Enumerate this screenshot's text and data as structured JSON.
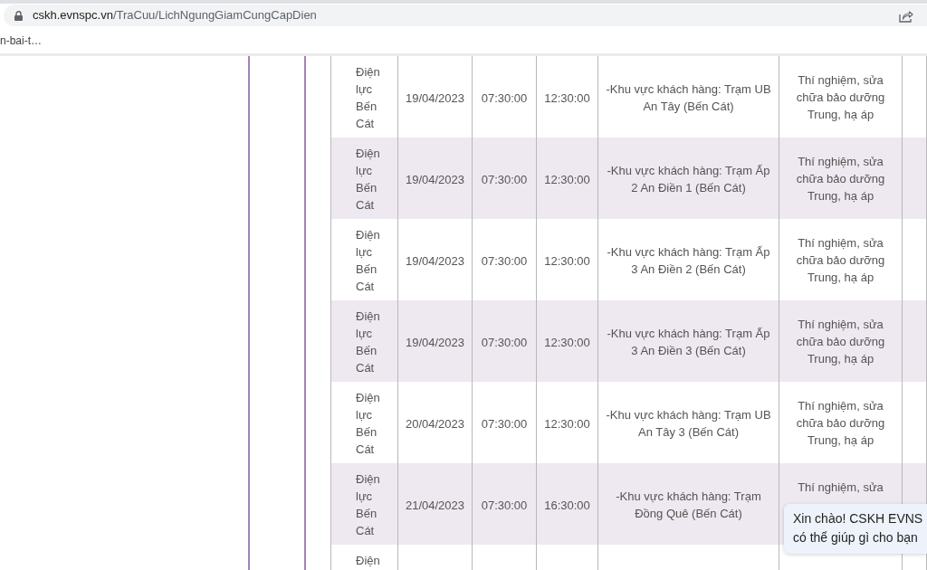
{
  "browser": {
    "address": {
      "host": "cskh.evnspc.vn",
      "path": "/TraCuu/LichNgungGiamCungCapDien"
    },
    "bookmarks": [
      {
        "label": "n-bai-t…"
      }
    ]
  },
  "table": {
    "rows": [
      {
        "cells": [
          "Điện lực Bến Cát",
          "19/04/2023",
          "07:30:00",
          "12:30:00",
          "-Khu vực khách hàng: Trạm UB An Tây (Bến Cát)",
          "Thí nghiệm, sửa chữa bảo dưỡng Trung, hạ áp"
        ]
      },
      {
        "cells": [
          "Điện lực Bến Cát",
          "19/04/2023",
          "07:30:00",
          "12:30:00",
          "-Khu vực khách hàng: Trạm Ấp 2 An Điền 1 (Bến Cát)",
          "Thí nghiệm, sửa chữa bảo dưỡng Trung, hạ áp"
        ]
      },
      {
        "cells": [
          "Điện lực Bến Cát",
          "19/04/2023",
          "07:30:00",
          "12:30:00",
          "-Khu vực khách hàng: Trạm Ấp 3 An Điền 2 (Bến Cát)",
          "Thí nghiệm, sửa chữa bảo dưỡng Trung, hạ áp"
        ]
      },
      {
        "cells": [
          "Điện lực Bến Cát",
          "19/04/2023",
          "07:30:00",
          "12:30:00",
          "-Khu vực khách hàng: Trạm Ấp 3 An Điền 3 (Bến Cát)",
          "Thí nghiệm, sửa chữa bảo dưỡng Trung, hạ áp"
        ]
      },
      {
        "cells": [
          "Điện lực Bến Cát",
          "20/04/2023",
          "07:30:00",
          "12:30:00",
          "-Khu vực khách hàng: Trạm UB An Tây 3 (Bến Cát)",
          "Thí nghiệm, sửa chữa bảo dưỡng Trung, hạ áp"
        ]
      },
      {
        "cells": [
          "Điện lực Bến Cát",
          "21/04/2023",
          "07:30:00",
          "16:30:00",
          "-Khu vực khách hàng: Trạm Đồng Quê (Bến Cát)",
          "Thí nghiệm, sửa"
        ]
      },
      {
        "cells": [
          "Điện"
        ]
      }
    ]
  },
  "chat_popup": {
    "lines": [
      "Xin chào! CSKH EVNS",
      "có thể giúp gì cho bạn"
    ]
  }
}
